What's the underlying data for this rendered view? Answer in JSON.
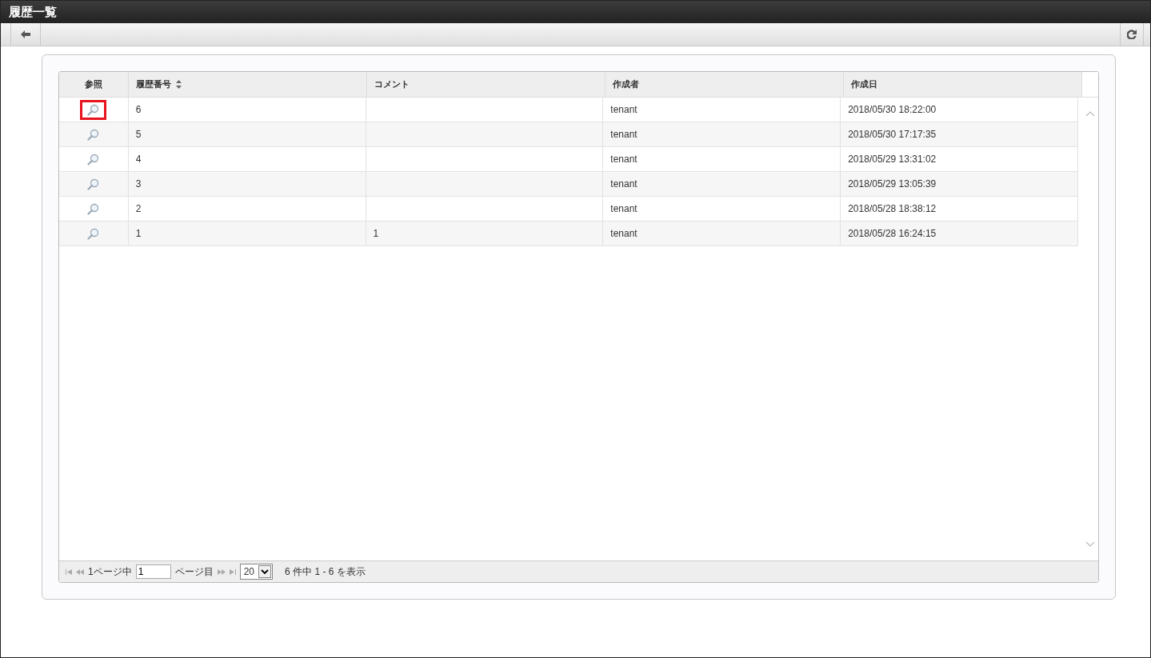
{
  "window": {
    "title": "履歴一覧"
  },
  "table": {
    "columns": [
      {
        "label": "参照",
        "sortable": false
      },
      {
        "label": "履歴番号",
        "sortable": true
      },
      {
        "label": "コメント",
        "sortable": false
      },
      {
        "label": "作成者",
        "sortable": false
      },
      {
        "label": "作成日",
        "sortable": false
      }
    ],
    "rows": [
      {
        "number": "6",
        "comment": "",
        "author": "tenant",
        "created": "2018/05/30 18:22:00",
        "highlighted": true
      },
      {
        "number": "5",
        "comment": "",
        "author": "tenant",
        "created": "2018/05/30 17:17:35",
        "highlighted": false
      },
      {
        "number": "4",
        "comment": "",
        "author": "tenant",
        "created": "2018/05/29 13:31:02",
        "highlighted": false
      },
      {
        "number": "3",
        "comment": "",
        "author": "tenant",
        "created": "2018/05/29 13:05:39",
        "highlighted": false
      },
      {
        "number": "2",
        "comment": "",
        "author": "tenant",
        "created": "2018/05/28 18:38:12",
        "highlighted": false
      },
      {
        "number": "1",
        "comment": "1",
        "author": "tenant",
        "created": "2018/05/28 16:24:15",
        "highlighted": false
      }
    ]
  },
  "pager": {
    "page_total": "1ページ中",
    "page_value": "1",
    "page_suffix": "ページ目",
    "page_size": "20",
    "summary": "6 件中 1 - 6 を表示"
  }
}
